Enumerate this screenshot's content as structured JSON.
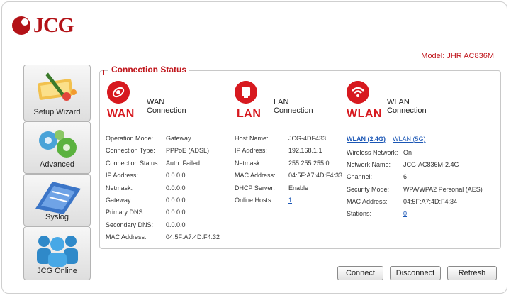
{
  "brand": {
    "logo_text": "JCG",
    "logo_mark": "e"
  },
  "model": "Model: JHR AC836M",
  "sidebar": {
    "items": [
      {
        "label": "Setup Wizard",
        "icon": "setup-wizard-icon"
      },
      {
        "label": "Advanced",
        "icon": "gears-icon"
      },
      {
        "label": "Syslog",
        "icon": "syslog-icon"
      },
      {
        "label": "JCG Online",
        "icon": "users-icon"
      }
    ]
  },
  "panel": {
    "title": "Connection Status",
    "wan": {
      "big": "WAN",
      "title": "WAN Connection",
      "rows": [
        {
          "k": "Operation Mode:",
          "v": "Gateway"
        },
        {
          "k": "Connection Type:",
          "v": "PPPoE (ADSL)"
        },
        {
          "k": "Connection Status:",
          "v": "Auth. Failed"
        },
        {
          "k": "IP Address:",
          "v": "0.0.0.0"
        },
        {
          "k": "Netmask:",
          "v": "0.0.0.0"
        },
        {
          "k": "Gateway:",
          "v": "0.0.0.0"
        },
        {
          "k": "Primary DNS:",
          "v": "0.0.0.0"
        },
        {
          "k": "Secondary DNS:",
          "v": "0.0.0.0"
        },
        {
          "k": "MAC Address:",
          "v": "04:5F:A7:4D:F4:32"
        }
      ]
    },
    "lan": {
      "big": "LAN",
      "title": "LAN Connection",
      "rows": [
        {
          "k": "Host Name:",
          "v": "JCG-4DF433"
        },
        {
          "k": "IP Address:",
          "v": "192.168.1.1"
        },
        {
          "k": "Netmask:",
          "v": "255.255.255.0"
        },
        {
          "k": "MAC Address:",
          "v": "04:5F:A7:4D:F4:33"
        },
        {
          "k": "DHCP Server:",
          "v": "Enable"
        },
        {
          "k": "Online Hosts:",
          "v": "1"
        }
      ]
    },
    "wlan": {
      "big": "WLAN",
      "title": "WLAN Connection",
      "tab_24": "WLAN (2.4G)",
      "tab_5": "WLAN (5G)",
      "rows": [
        {
          "k": "Wireless Network:",
          "v": "On"
        },
        {
          "k": "Network Name:",
          "v": "JCG-AC836M-2.4G"
        },
        {
          "k": "Channel:",
          "v": "6"
        },
        {
          "k": "Security Mode:",
          "v": "WPA/WPA2 Personal (AES)"
        },
        {
          "k": "MAC Address:",
          "v": "04:5F:A7:4D:F4:34"
        },
        {
          "k": "Stations:",
          "v": "0"
        }
      ]
    }
  },
  "buttons": {
    "connect": "Connect",
    "disconnect": "Disconnect",
    "refresh": "Refresh"
  },
  "colors": {
    "accent": "#d7191f",
    "link": "#1a56b5"
  }
}
